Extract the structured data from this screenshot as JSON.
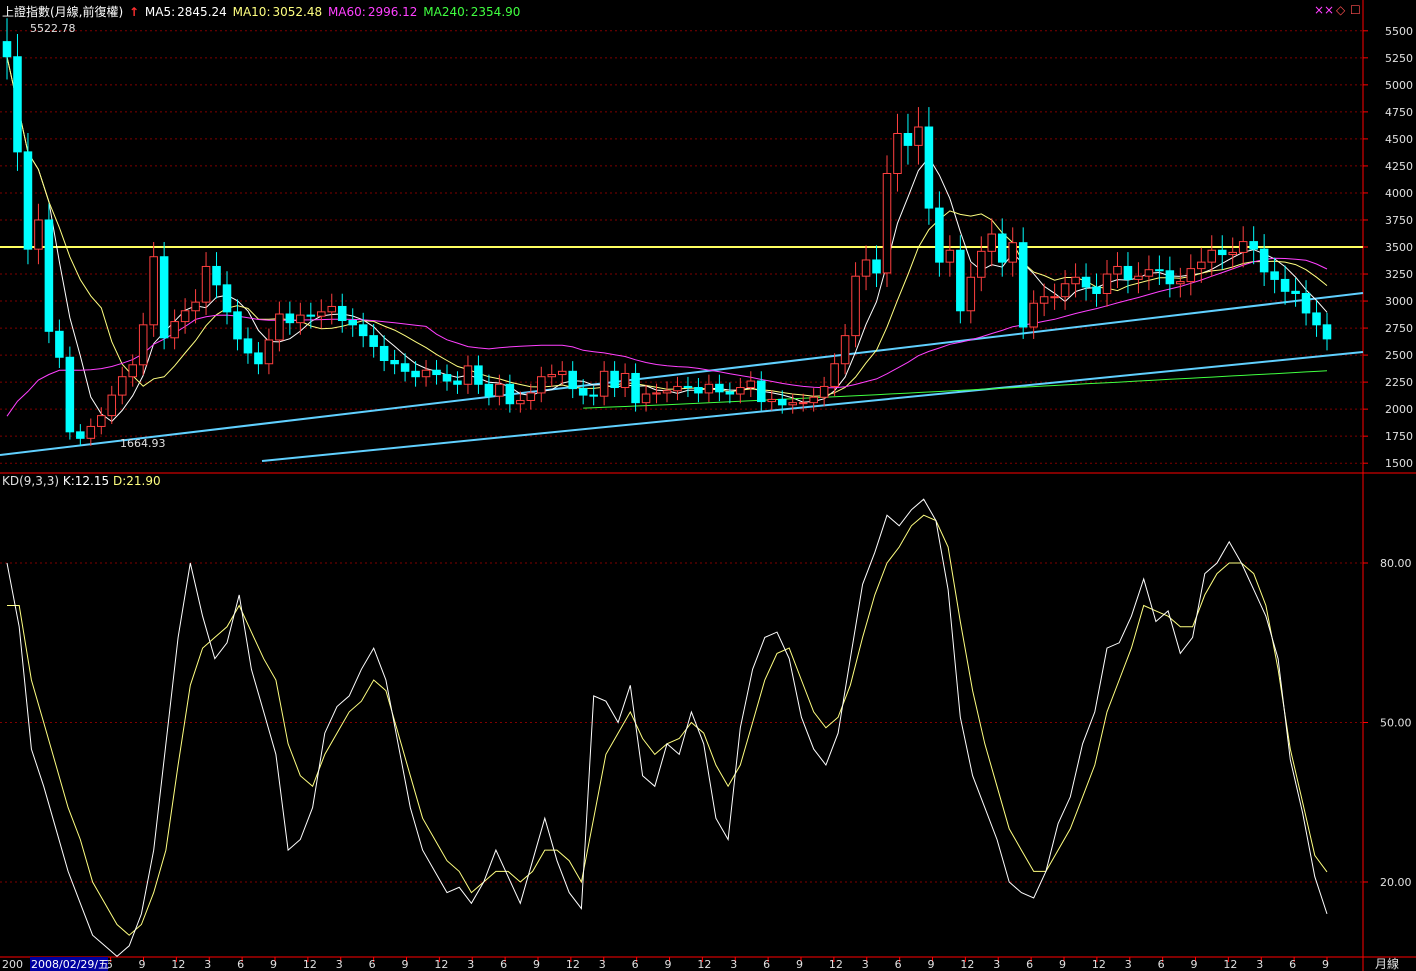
{
  "header": {
    "instrument": "上證指數(月線,前復權)",
    "up_arrow_glyph": "↑",
    "ma": [
      {
        "label": "MA5:",
        "value": "2845.24",
        "color": "#ffffff"
      },
      {
        "label": "MA10:",
        "value": "3052.48",
        "color": "#ffff80"
      },
      {
        "label": "MA60:",
        "value": "2996.12",
        "color": "#ff40ff"
      },
      {
        "label": "MA240:",
        "value": "2354.90",
        "color": "#40ff40"
      }
    ],
    "icons": {
      "close": "×",
      "diamond": "◇",
      "box": "☐"
    }
  },
  "kd_header": {
    "label": "KD(9,3,3)",
    "k_label": "K:",
    "k_value": "12.15",
    "d_label": "D:",
    "d_value": "21.90"
  },
  "annotations": {
    "high": "5522.78",
    "low": "1664.93"
  },
  "date_cursor": "2008/02/29/五",
  "x_label_left": "200",
  "period_label": "月線",
  "colors": {
    "up": "#ff4040",
    "down": "#00ffff",
    "ma5": "#ffffff",
    "ma10": "#ffff80",
    "ma60": "#ff40ff",
    "ma240": "#40ff40",
    "hline": "#ffff60",
    "trend": "#60d0ff",
    "grid": "#800000",
    "axis": "#ff0000"
  },
  "chart_data": [
    {
      "type": "candlestick",
      "title": "上證指數(月線,前復權)",
      "ylim": [
        1400,
        5600
      ],
      "y_ticks": [
        1500,
        1750,
        2000,
        2250,
        2500,
        2750,
        3000,
        3250,
        3500,
        3750,
        4000,
        4250,
        4500,
        4750,
        5000,
        5250,
        5500
      ],
      "x_tick_labels": [
        "200",
        "12",
        "3",
        "6",
        "9",
        "12",
        "3",
        "6",
        "9",
        "12",
        "3",
        "6",
        "9",
        "12",
        "3",
        "6",
        "9",
        "12",
        "3",
        "6",
        "9",
        "12",
        "3",
        "6",
        "9",
        "12",
        "3",
        "6",
        "9",
        "12",
        "3",
        "6",
        "9",
        "12",
        "3",
        "6",
        "9",
        "12",
        "3",
        "6",
        "9"
      ],
      "horizontal_line": 3500,
      "closes": [
        5260,
        4380,
        3480,
        3750,
        2720,
        2480,
        1790,
        1730,
        1840,
        1940,
        2130,
        2300,
        2410,
        2780,
        3410,
        2660,
        2810,
        2910,
        2990,
        3320,
        3150,
        2900,
        2650,
        2520,
        2420,
        2640,
        2880,
        2800,
        2870,
        2860,
        2900,
        2950,
        2820,
        2780,
        2680,
        2580,
        2450,
        2420,
        2350,
        2300,
        2360,
        2320,
        2260,
        2230,
        2400,
        2230,
        2120,
        2230,
        2050,
        2080,
        2150,
        2300,
        2320,
        2350,
        2190,
        2130,
        2120,
        2350,
        2200,
        2330,
        2060,
        2140,
        2150,
        2170,
        2210,
        2200,
        2150,
        2230,
        2160,
        2140,
        2200,
        2260,
        2070,
        2090,
        2040,
        2060,
        2060,
        2110,
        2210,
        2420,
        2680,
        3230,
        3380,
        3260,
        4180,
        4550,
        4440,
        4610,
        3860,
        3360,
        3470,
        2910,
        3220,
        3460,
        3620,
        3360,
        3540,
        2760,
        2980,
        3040,
        3040,
        3160,
        3220,
        3130,
        3070,
        3250,
        3320,
        3200,
        3230,
        3290,
        3280,
        3160,
        3180,
        3300,
        3360,
        3470,
        3430,
        3450,
        3550,
        3480,
        3270,
        3200,
        3090,
        3070,
        2890,
        2780,
        2650
      ],
      "ma240_start": 2010,
      "ma240_end": 2354.9,
      "k_values": [
        80,
        68,
        45,
        38,
        30,
        22,
        16,
        10,
        8,
        6,
        8,
        14,
        26,
        46,
        66,
        80,
        70,
        62,
        65,
        74,
        60,
        52,
        44,
        26,
        28,
        34,
        48,
        53,
        55,
        60,
        64,
        58,
        46,
        34,
        26,
        22,
        18,
        19,
        16,
        20,
        26,
        21,
        16,
        24,
        32,
        24,
        18,
        15,
        55,
        54,
        50,
        57,
        40,
        38,
        46,
        44,
        52,
        46,
        32,
        28,
        49,
        60,
        66,
        67,
        62,
        51,
        45,
        42,
        48,
        62,
        76,
        82,
        89,
        87,
        90,
        92,
        88,
        75,
        51,
        40,
        34,
        28,
        20,
        18,
        17,
        22,
        31,
        36,
        46,
        52,
        64,
        65,
        70,
        77,
        69,
        71,
        63,
        66,
        78,
        80,
        84,
        80,
        75,
        70,
        62,
        43,
        33,
        21,
        14
      ],
      "d_values": [
        72,
        72,
        58,
        50,
        42,
        34,
        28,
        20,
        16,
        12,
        10,
        12,
        18,
        26,
        42,
        57,
        64,
        66,
        68,
        72,
        67,
        62,
        58,
        46,
        40,
        38,
        44,
        48,
        52,
        54,
        58,
        56,
        48,
        40,
        32,
        28,
        24,
        22,
        18,
        20,
        22,
        22,
        20,
        22,
        26,
        26,
        24,
        20,
        32,
        44,
        48,
        52,
        47,
        44,
        46,
        47,
        50,
        48,
        42,
        38,
        42,
        50,
        58,
        63,
        64,
        58,
        52,
        49,
        51,
        57,
        66,
        74,
        80,
        83,
        87,
        89,
        88,
        83,
        69,
        56,
        46,
        38,
        30,
        26,
        22,
        22,
        26,
        30,
        36,
        42,
        52,
        58,
        64,
        72,
        71,
        70,
        68,
        68,
        74,
        78,
        80,
        80,
        78,
        72,
        60,
        45,
        35,
        25,
        21.9
      ],
      "kd_ylim": [
        0,
        100
      ],
      "kd_ticks": [
        20,
        50,
        80
      ]
    }
  ]
}
